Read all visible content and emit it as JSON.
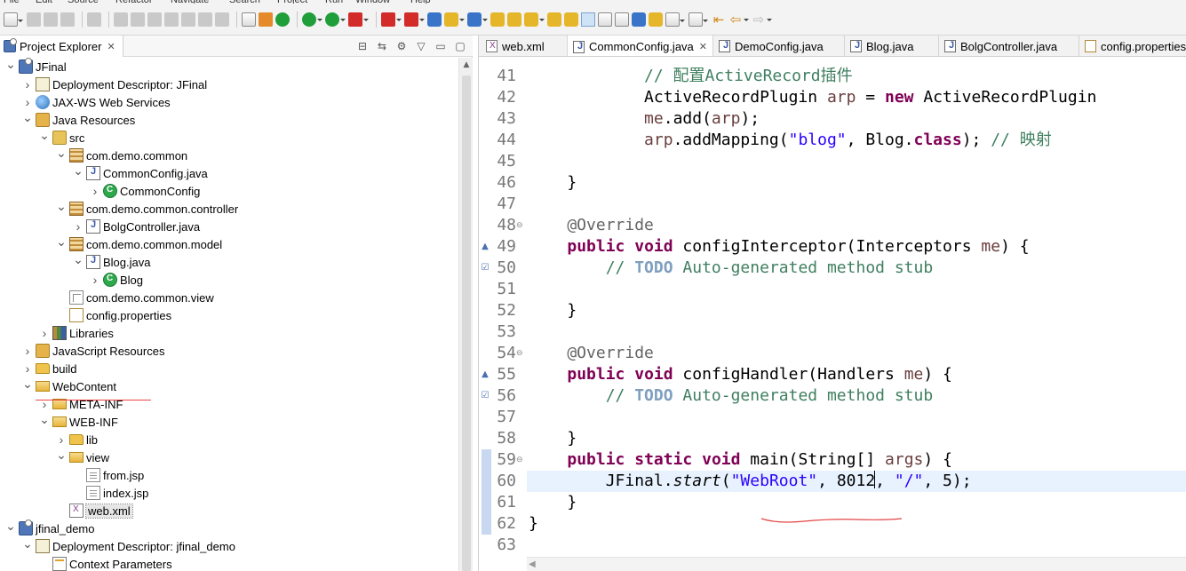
{
  "menu": [
    "File",
    "Edit",
    "Source",
    "Refactor",
    "Navigate",
    "Search",
    "Project",
    "Run",
    "Window",
    "Help"
  ],
  "project_explorer": {
    "title": "Project Explorer",
    "tree": [
      {
        "label": "JFinal",
        "icon": "project-icon",
        "twisty": "open"
      },
      {
        "label": "Deployment Descriptor: JFinal",
        "icon": "deployment-descriptor-icon",
        "twisty": "closed"
      },
      {
        "label": "JAX-WS Web Services",
        "icon": "web-services-icon",
        "twisty": "closed"
      },
      {
        "label": "Java Resources",
        "icon": "java-resources-icon",
        "twisty": "open"
      },
      {
        "label": "src",
        "icon": "source-folder-icon",
        "twisty": "open"
      },
      {
        "label": "com.demo.common",
        "icon": "package-icon",
        "twisty": "open"
      },
      {
        "label": "CommonConfig.java",
        "icon": "java-file-icon",
        "twisty": "open"
      },
      {
        "label": "CommonConfig",
        "icon": "class-icon",
        "twisty": "closed"
      },
      {
        "label": "com.demo.common.controller",
        "icon": "package-icon",
        "twisty": "open"
      },
      {
        "label": "BolgController.java",
        "icon": "java-file-icon",
        "twisty": "closed"
      },
      {
        "label": "com.demo.common.model",
        "icon": "package-icon",
        "twisty": "open"
      },
      {
        "label": "Blog.java",
        "icon": "java-file-icon",
        "twisty": "open"
      },
      {
        "label": "Blog",
        "icon": "class-icon",
        "twisty": "closed"
      },
      {
        "label": "com.demo.common.view",
        "icon": "empty-package-icon",
        "twisty": "none"
      },
      {
        "label": "config.properties",
        "icon": "properties-file-icon",
        "twisty": "none"
      },
      {
        "label": "Libraries",
        "icon": "libraries-icon",
        "twisty": "closed"
      },
      {
        "label": "JavaScript Resources",
        "icon": "javascript-resources-icon",
        "twisty": "closed"
      },
      {
        "label": "build",
        "icon": "folder-icon",
        "twisty": "closed"
      },
      {
        "label": "WebContent",
        "icon": "folder-open-icon",
        "twisty": "open"
      },
      {
        "label": "META-INF",
        "icon": "folder-open-icon",
        "twisty": "closed"
      },
      {
        "label": "WEB-INF",
        "icon": "folder-open-icon",
        "twisty": "open"
      },
      {
        "label": "lib",
        "icon": "folder-icon",
        "twisty": "closed"
      },
      {
        "label": "view",
        "icon": "folder-open-icon",
        "twisty": "open"
      },
      {
        "label": "from.jsp",
        "icon": "jsp-file-icon",
        "twisty": "none"
      },
      {
        "label": "index.jsp",
        "icon": "jsp-file-icon",
        "twisty": "none"
      },
      {
        "label": "web.xml",
        "icon": "xml-file-icon",
        "twisty": "none",
        "selected": true
      },
      {
        "label": "jfinal_demo",
        "icon": "project-icon",
        "twisty": "open"
      },
      {
        "label": "Deployment Descriptor: jfinal_demo",
        "icon": "deployment-descriptor-icon",
        "twisty": "open"
      },
      {
        "label": "Context Parameters",
        "icon": "context-parameters-icon",
        "twisty": "none"
      }
    ]
  },
  "editor": {
    "tabs": [
      {
        "label": "web.xml",
        "icon": "xml-file-icon",
        "active": false
      },
      {
        "label": "CommonConfig.java",
        "icon": "java-file-icon",
        "active": true,
        "close": "✕"
      },
      {
        "label": "DemoConfig.java",
        "icon": "java-file-icon",
        "active": false
      },
      {
        "label": "Blog.java",
        "icon": "java-file-icon",
        "active": false
      },
      {
        "label": "BolgController.java",
        "icon": "java-file-icon",
        "active": false
      },
      {
        "label": "config.properties",
        "icon": "properties-file-icon",
        "active": false
      }
    ],
    "current_line": "60",
    "lines": [
      {
        "n": "41",
        "tokens": [
          [
            "cm",
            "            // 配置ActiveRecord插件"
          ]
        ]
      },
      {
        "n": "42",
        "tokens": [
          [
            "",
            "            ActiveRecordPlugin "
          ],
          [
            "par",
            "arp"
          ],
          [
            "",
            " = "
          ],
          [
            "kw",
            "new"
          ],
          [
            "",
            " ActiveRecordPlugin"
          ]
        ]
      },
      {
        "n": "43",
        "tokens": [
          [
            "",
            "            "
          ],
          [
            "par",
            "me"
          ],
          [
            "",
            ".add("
          ],
          [
            "par",
            "arp"
          ],
          [
            "",
            ");"
          ]
        ]
      },
      {
        "n": "44",
        "tokens": [
          [
            "",
            "            "
          ],
          [
            "par",
            "arp"
          ],
          [
            "",
            ".addMapping("
          ],
          [
            "st",
            "\"blog\""
          ],
          [
            "",
            ", Blog."
          ],
          [
            "kw",
            "class"
          ],
          [
            "",
            "); "
          ],
          [
            "cm",
            "// 映射"
          ]
        ]
      },
      {
        "n": "45",
        "tokens": []
      },
      {
        "n": "46",
        "tokens": [
          [
            "",
            "    }"
          ]
        ]
      },
      {
        "n": "47",
        "tokens": []
      },
      {
        "n": "48",
        "fold": "⊖",
        "tokens": [
          [
            "an",
            "    @Override"
          ]
        ]
      },
      {
        "n": "49",
        "ann": "▲",
        "tokens": [
          [
            "",
            "    "
          ],
          [
            "kw",
            "public"
          ],
          [
            "",
            " "
          ],
          [
            "kw",
            "void"
          ],
          [
            "",
            " configInterceptor(Interceptors "
          ],
          [
            "par",
            "me"
          ],
          [
            "",
            ") {"
          ]
        ]
      },
      {
        "n": "50",
        "ann": "☑",
        "tokens": [
          [
            "cm",
            "        // "
          ],
          [
            "td",
            "TODO"
          ],
          [
            "cm",
            " Auto-generated method stub"
          ]
        ]
      },
      {
        "n": "51",
        "tokens": []
      },
      {
        "n": "52",
        "tokens": [
          [
            "",
            "    }"
          ]
        ]
      },
      {
        "n": "53",
        "tokens": []
      },
      {
        "n": "54",
        "fold": "⊖",
        "tokens": [
          [
            "an",
            "    @Override"
          ]
        ]
      },
      {
        "n": "55",
        "ann": "▲",
        "tokens": [
          [
            "",
            "    "
          ],
          [
            "kw",
            "public"
          ],
          [
            "",
            " "
          ],
          [
            "kw",
            "void"
          ],
          [
            "",
            " configHandler(Handlers "
          ],
          [
            "par",
            "me"
          ],
          [
            "",
            ") {"
          ]
        ]
      },
      {
        "n": "56",
        "ann": "☑",
        "tokens": [
          [
            "cm",
            "        // "
          ],
          [
            "td",
            "TODO"
          ],
          [
            "cm",
            " Auto-generated method stub"
          ]
        ]
      },
      {
        "n": "57",
        "tokens": []
      },
      {
        "n": "58",
        "tokens": [
          [
            "",
            "    }"
          ]
        ]
      },
      {
        "n": "59",
        "fold": "⊖",
        "tokens": [
          [
            "",
            "    "
          ],
          [
            "kw",
            "public"
          ],
          [
            "",
            " "
          ],
          [
            "kw",
            "static"
          ],
          [
            "",
            " "
          ],
          [
            "kw",
            "void"
          ],
          [
            "",
            " main(String[] "
          ],
          [
            "par",
            "args"
          ],
          [
            "",
            ") {"
          ]
        ]
      },
      {
        "n": "60",
        "tokens": [
          [
            "",
            "        JFinal."
          ],
          [
            "it",
            "start"
          ],
          [
            "",
            "("
          ],
          [
            "st",
            "\"WebRoot\""
          ],
          [
            "",
            ", 8012"
          ],
          [
            "caret",
            ""
          ],
          [
            "",
            ", "
          ],
          [
            "st",
            "\"/\""
          ],
          [
            "",
            ", 5);"
          ]
        ]
      },
      {
        "n": "61",
        "tokens": [
          [
            "",
            "    }"
          ]
        ]
      },
      {
        "n": "62",
        "tokens": [
          [
            "",
            "}"
          ]
        ]
      },
      {
        "n": "63",
        "tokens": []
      }
    ]
  },
  "colors": {
    "keyword": "#7f0055",
    "comment": "#3f7f5f",
    "string": "#2a00ff",
    "annotation": "#646464",
    "current_line": "#e8f2fe",
    "annotation_underline": "#e44444"
  }
}
